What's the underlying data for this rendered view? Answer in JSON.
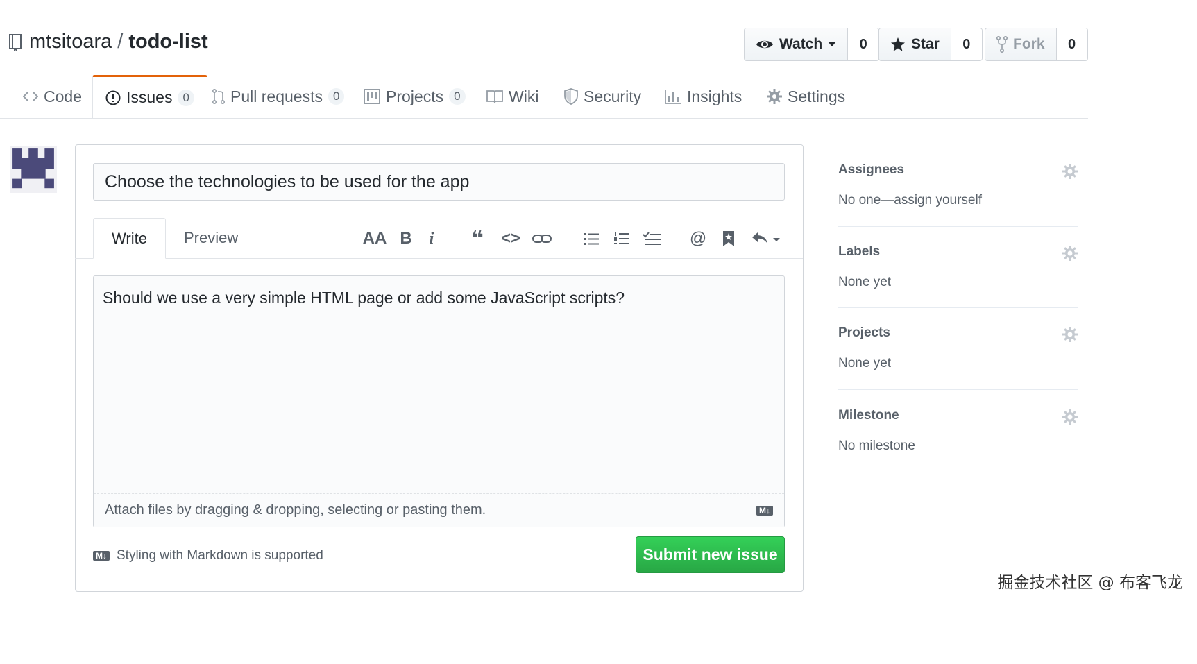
{
  "repo": {
    "owner": "mtsitoara",
    "separator": "/",
    "name": "todo-list"
  },
  "actions": {
    "watch": {
      "label": "Watch",
      "count": "0"
    },
    "star": {
      "label": "Star",
      "count": "0"
    },
    "fork": {
      "label": "Fork",
      "count": "0"
    }
  },
  "tabs": [
    {
      "label": "Code",
      "icon": "code-icon"
    },
    {
      "label": "Issues",
      "count": "0",
      "icon": "issue-opened-icon",
      "selected": true
    },
    {
      "label": "Pull requests",
      "count": "0",
      "icon": "git-pull-request-icon"
    },
    {
      "label": "Projects",
      "count": "0",
      "icon": "project-icon"
    },
    {
      "label": "Wiki",
      "icon": "book-icon"
    },
    {
      "label": "Security",
      "icon": "shield-icon"
    },
    {
      "label": "Insights",
      "icon": "graph-icon"
    },
    {
      "label": "Settings",
      "icon": "gear-icon"
    }
  ],
  "issue": {
    "title": "Choose the technologies to be used for the app",
    "body": "Should we use a very simple HTML page or add some JavaScript scripts?",
    "write_tab": "Write",
    "preview_tab": "Preview",
    "toolbar": {
      "header": "AA",
      "bold": "B",
      "italic": "i",
      "quote": "❝",
      "code": "<>",
      "link": "link-icon",
      "ul": "unordered-list-icon",
      "ol": "ordered-list-icon",
      "tasklist": "tasklist-icon",
      "mention": "@",
      "reference": "bookmark-icon",
      "reply": "reply-icon"
    },
    "attach_text": "Attach files by dragging & dropping, selecting or pasting them.",
    "markdown_note": "Styling with Markdown is supported",
    "markdown_badge": "M↓",
    "submit_label": "Submit new issue"
  },
  "sidebar": {
    "assignees": {
      "heading": "Assignees",
      "value": "No one—assign yourself"
    },
    "labels": {
      "heading": "Labels",
      "value": "None yet"
    },
    "projects": {
      "heading": "Projects",
      "value": "None yet"
    },
    "milestone": {
      "heading": "Milestone",
      "value": "No milestone"
    }
  },
  "watermark": "掘金技术社区 @ 布客飞龙",
  "colors": {
    "accent_tab": "#e36209",
    "submit_green": "#28a745",
    "text": "#24292e",
    "muted": "#586069"
  }
}
